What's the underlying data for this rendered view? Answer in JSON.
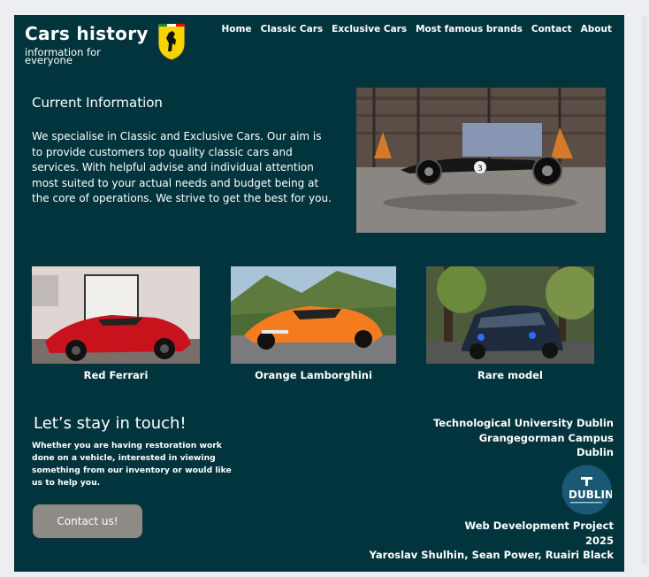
{
  "header": {
    "title": "Cars history",
    "subtitle": "information for everyone",
    "logo": "ferrari-prancing-horse-icon"
  },
  "nav": {
    "items": [
      "Home",
      "Classic Cars",
      "Exclusive Cars",
      "Most famous brands",
      "Contact",
      "About"
    ]
  },
  "info": {
    "title": "Current Information",
    "text": "We specialise in Classic and Exclusive Cars. Our aim is to provide customers top quality classic cars and services. With helpful advise and individual attention most suited to your actual needs and budget being at the core of operations. We strive to get the best for you."
  },
  "cards": [
    {
      "label": "Red Ferrari"
    },
    {
      "label": "Orange Lamborghini"
    },
    {
      "label": "Rare model"
    }
  ],
  "touch": {
    "title": "Let’s stay in touch!",
    "text": "Whether you are having restoration work done on a vehicle, interested in viewing something from our inventory or would like us to help you.",
    "button": "Contact us!"
  },
  "address": {
    "line1": "Technological University Dublin",
    "line2": "Grangegorman Campus",
    "line3": "Dublin",
    "logo_text": "DUBLIN"
  },
  "credits": {
    "line1": "Web Development Project",
    "line2": "2025",
    "line3": "Yaroslav Shulhin, Sean Power, Ruairi Black"
  },
  "colors": {
    "page_bg": "#02343d",
    "button_bg": "#8e8a86",
    "text": "#ffffff"
  }
}
